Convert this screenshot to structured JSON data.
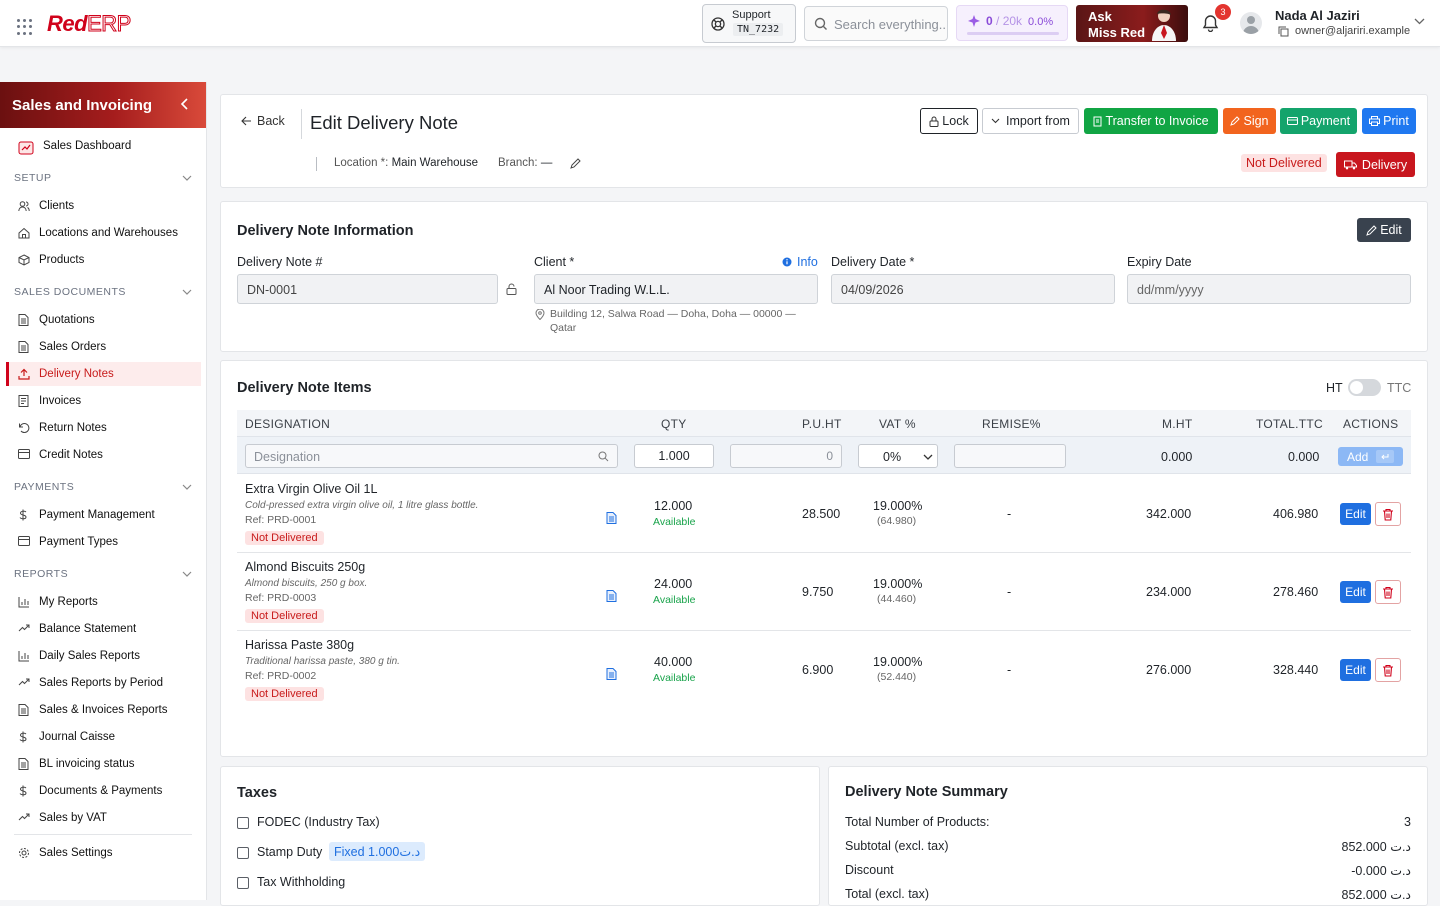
{
  "topbar": {
    "logo_red": "Red",
    "logo_erp": "ERP",
    "support_label": "Support",
    "support_code": "TN_7232",
    "search_placeholder": "Search everything...",
    "credits_used": "0",
    "credits_total": "/ 20k",
    "credits_pct": "0.0%",
    "ask_line1": "Ask",
    "ask_line2": "Miss Red",
    "notif_count": "3",
    "user_name": "Nada Al Jaziri",
    "user_email": "owner@aljariri.example"
  },
  "sidebar": {
    "title": "Sales and Invoicing",
    "dashboard": "Sales Dashboard",
    "sections": {
      "setup": "SETUP",
      "sales_docs": "SALES DOCUMENTS",
      "payments": "PAYMENTS",
      "reports": "REPORTS"
    },
    "setup_items": [
      "Clients",
      "Locations and Warehouses",
      "Products"
    ],
    "sales_items": [
      "Quotations",
      "Sales Orders",
      "Delivery Notes",
      "Invoices",
      "Return Notes",
      "Credit Notes"
    ],
    "payment_items": [
      "Payment Management",
      "Payment Types"
    ],
    "report_items": [
      "My Reports",
      "Balance Statement",
      "Daily Sales Reports",
      "Sales Reports by Period",
      "Sales & Invoices Reports",
      "Journal Caisse",
      "BL invoicing status",
      "Documents & Payments",
      "Sales by VAT"
    ],
    "settings": "Sales Settings"
  },
  "header": {
    "back": "Back",
    "title": "Edit Delivery Note",
    "lock": "Lock",
    "import_from": "Import from",
    "transfer": "Transfer to Invoice",
    "sign": "Sign",
    "payment": "Payment",
    "print": "Print",
    "location_label": "Location *:",
    "location_value": "Main Warehouse",
    "branch_label": "Branch:",
    "branch_value": "—",
    "status": "Not Delivered",
    "delivery_btn": "Delivery"
  },
  "info": {
    "title": "Delivery Note Information",
    "edit": "Edit",
    "number_label": "Delivery Note #",
    "number_value": "DN-0001",
    "client_label": "Client *",
    "info_link": "Info",
    "client_value": "Al Noor Trading W.L.L.",
    "client_address_1": "Building 12, Salwa Road — Doha, Doha — 00000 —",
    "client_address_2": "Qatar",
    "date_label": "Delivery Date *",
    "date_value": "04/09/2026",
    "expiry_label": "Expiry Date",
    "expiry_placeholder": "dd/mm/yyyy"
  },
  "items": {
    "title": "Delivery Note Items",
    "ht": "HT",
    "ttc": "TTC",
    "columns": [
      "DESIGNATION",
      "QTY",
      "P.U.HT",
      "VAT %",
      "REMISE%",
      "M.HT",
      "TOTAL.TTC",
      "ACTIONS"
    ],
    "new_row": {
      "designation_placeholder": "Designation",
      "qty": "1.000",
      "price_placeholder": "0",
      "vat": "0%",
      "mht": "0.000",
      "ttc": "0.000",
      "add": "Add"
    },
    "rows": [
      {
        "name": "Extra Virgin Olive Oil 1L",
        "desc": "Cold-pressed extra virgin olive oil, 1 litre glass bottle.",
        "ref": "Ref: PRD-0001",
        "status": "Not Delivered",
        "qty": "12.000",
        "avail": "Available",
        "price": "28.500",
        "vat": "19.000%",
        "vat_amt": "(64.980)",
        "remise": "-",
        "mht": "342.000",
        "ttc": "406.980",
        "edit": "Edit"
      },
      {
        "name": "Almond Biscuits 250g",
        "desc": "Almond biscuits, 250 g box.",
        "ref": "Ref: PRD-0003",
        "status": "Not Delivered",
        "qty": "24.000",
        "avail": "Available",
        "price": "9.750",
        "vat": "19.000%",
        "vat_amt": "(44.460)",
        "remise": "-",
        "mht": "234.000",
        "ttc": "278.460",
        "edit": "Edit"
      },
      {
        "name": "Harissa Paste 380g",
        "desc": "Traditional harissa paste, 380 g tin.",
        "ref": "Ref: PRD-0002",
        "status": "Not Delivered",
        "qty": "40.000",
        "avail": "Available",
        "price": "6.900",
        "vat": "19.000%",
        "vat_amt": "(52.440)",
        "remise": "-",
        "mht": "276.000",
        "ttc": "328.440",
        "edit": "Edit"
      }
    ]
  },
  "taxes": {
    "title": "Taxes",
    "fodec": "FODEC (Industry Tax)",
    "stamp": "Stamp Duty",
    "stamp_badge": "Fixed 1.000د.ت",
    "withholding": "Tax Withholding"
  },
  "summary": {
    "title": "Delivery Note Summary",
    "rows": [
      {
        "label": "Total Number of Products:",
        "value": "3"
      },
      {
        "label": "Subtotal (excl. tax)",
        "value": "852.000 د.ت"
      },
      {
        "label": "Discount",
        "value": "-0.000 د.ت"
      },
      {
        "label": "Total (excl. tax)",
        "value": "852.000 د.ت"
      }
    ]
  },
  "colors": {
    "brand": "#d0021b",
    "primary": "#1f78f0",
    "success": "#11a544"
  }
}
